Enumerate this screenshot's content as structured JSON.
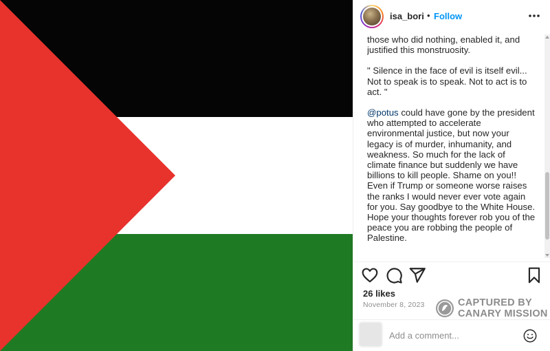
{
  "post": {
    "image": {
      "subject": "palestinian-flag",
      "colors": {
        "black": "#050505",
        "white": "#ffffff",
        "green": "#1e7a23",
        "red": "#e8322c"
      }
    },
    "author": {
      "username": "isa_bori",
      "separator": "•",
      "follow_label": "Follow"
    },
    "caption": {
      "line_1": "those who did nothing, enabled it, and justified this monstruosity.",
      "quote": "\" Silence in the face of evil is itself evil... Not to speak is to speak. Not to act is to act. \"",
      "mention": "@potus",
      "body": " could have gone by the president who attempted to accelerate environmental justice, but now your legacy is of murder, inhumanity, and weakness. So much for the lack of climate finance but suddenly we have billions to kill people. Shame on you!! Even if Trump or someone worse raises the ranks I would never ever vote again for you. Say goodbye to the White House. Hope your thoughts forever rob you of the peace you are robbing the people of Palestine."
    },
    "stats": {
      "likes": "26 likes",
      "date": "November 8, 2023"
    },
    "icons": {
      "more": "more-options-icon",
      "like": "heart-icon",
      "comment": "comment-icon",
      "share": "share-icon",
      "save": "bookmark-icon",
      "emoji": "emoji-icon"
    },
    "comment_box": {
      "placeholder": "Add a comment..."
    },
    "watermark": {
      "line_1": "CAPTURED BY",
      "line_2": "CANARY MISSION"
    },
    "accent_color": "#0095f6"
  }
}
